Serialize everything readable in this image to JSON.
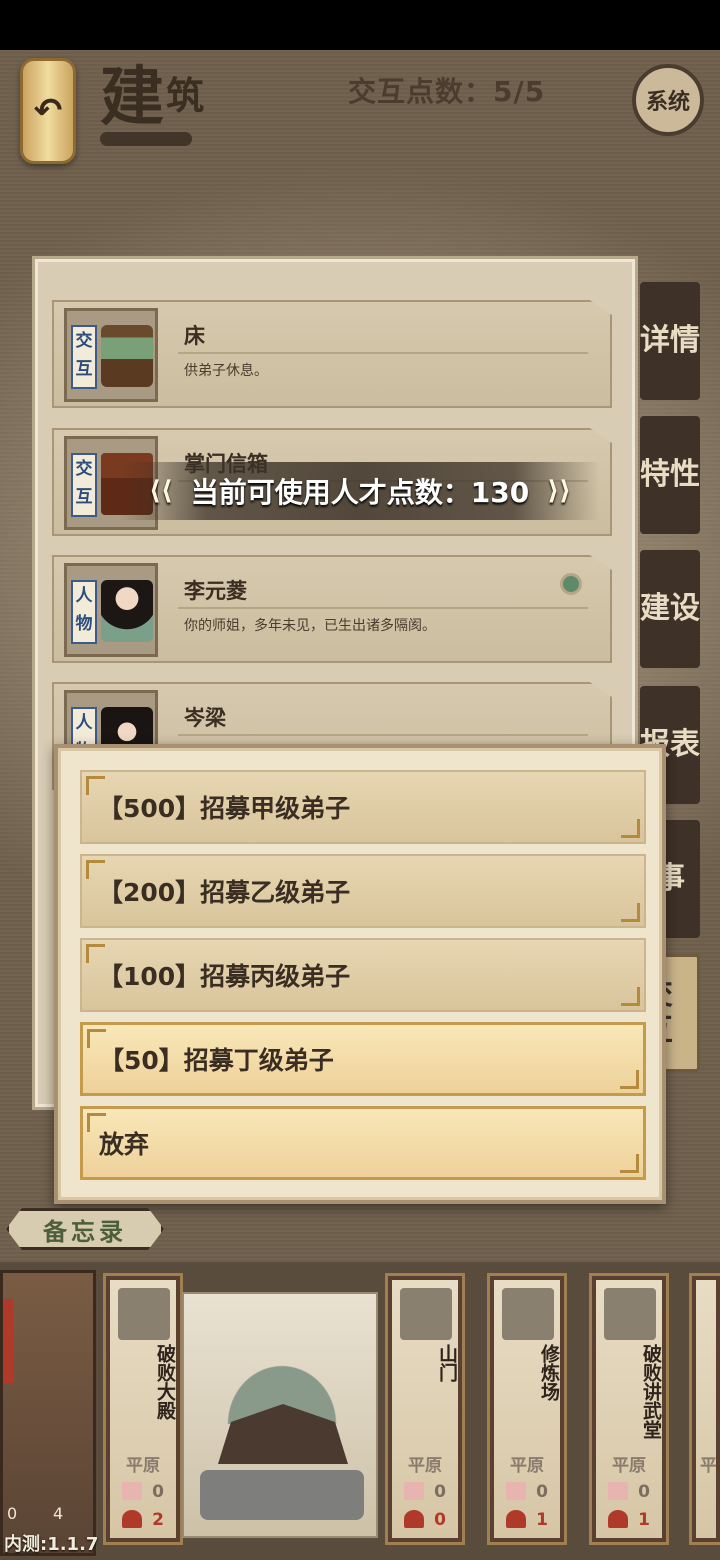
{
  "header": {
    "title_main": "建",
    "title_small": "筑",
    "interact_points": "交互点数：5/5",
    "system_label": "系统",
    "back_icon": "back-arrow-icon"
  },
  "list": [
    {
      "tag": "交互",
      "name": "床",
      "desc": "供弟子休息。"
    },
    {
      "tag": "交互",
      "name": "掌门信箱",
      "desc": ""
    },
    {
      "tag": "人物",
      "name": "李元菱",
      "desc": "你的师姐，多年未见，已生出诸多隔阂。"
    },
    {
      "tag": "人物",
      "name": "岑梁",
      "desc": ""
    }
  ],
  "side_tabs": [
    {
      "label": "详情"
    },
    {
      "label": "特性"
    },
    {
      "label": "建设"
    },
    {
      "label": "报表"
    },
    {
      "label": "事"
    },
    {
      "label": "交互"
    }
  ],
  "talent_banner": "当前可使用人才点数：130",
  "dialog": {
    "options": [
      {
        "label": "【500】招募甲级弟子"
      },
      {
        "label": "【200】招募乙级弟子"
      },
      {
        "label": "【100】招募丙级弟子"
      },
      {
        "label": "【50】招募丁级弟子"
      },
      {
        "label": "放弃"
      }
    ]
  },
  "memo_label": "备忘录",
  "left_card": {
    "stat_a": "0",
    "stat_b": "4"
  },
  "buildings": [
    {
      "name": "破败大殿",
      "terrain": "平原",
      "flags": "0",
      "people": "2"
    },
    {
      "name": "山门",
      "terrain": "平原",
      "flags": "0",
      "people": "0"
    },
    {
      "name": "修炼场",
      "terrain": "平原",
      "flags": "0",
      "people": "1"
    },
    {
      "name": "破败讲武堂",
      "terrain": "平原",
      "flags": "0",
      "people": "1"
    },
    {
      "name": "",
      "terrain": "平",
      "flags": "",
      "people": ""
    }
  ],
  "version": "内测:1.1.7",
  "colors": {
    "accent_gold": "#eed19a",
    "dark_brown": "#3e3127",
    "seal_red": "#b03a2a",
    "tag_blue": "#2c4d7e"
  }
}
